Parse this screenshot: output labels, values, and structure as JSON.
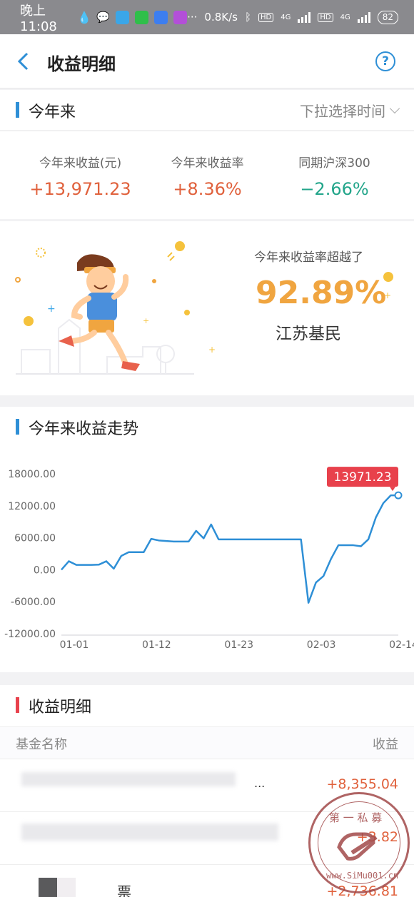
{
  "status_bar": {
    "time": "晚上11:08",
    "speed": "0.8K/s",
    "battery": "82",
    "hd1": "HD",
    "hd2": "HD",
    "net1": "4G",
    "net2": "4G",
    "dots": "···"
  },
  "header": {
    "title": "收益明细",
    "help": "?"
  },
  "period_section": {
    "title": "今年来",
    "selector": "下拉选择时间"
  },
  "stats": [
    {
      "label": "今年来收益(元)",
      "value": "+13,971.23",
      "color": "#e0613c"
    },
    {
      "label": "今年来收益率",
      "value": "+8.36%",
      "color": "#e0613c"
    },
    {
      "label": "同期沪深300",
      "value": "−2.66%",
      "color": "#22a58a"
    }
  ],
  "banner": {
    "label": "今年来收益率超越了",
    "value": "92.89%",
    "sub": "江苏基民"
  },
  "trend_section": {
    "title": "今年来收益走势"
  },
  "chart_data": {
    "type": "line",
    "x_ticks": [
      "01-01",
      "01-12",
      "01-23",
      "02-03",
      "02-14"
    ],
    "y_ticks": [
      "18000.00",
      "12000.00",
      "6000.00",
      "0.00",
      "-6000.00",
      "-12000.00"
    ],
    "ylim": [
      -12000,
      18000
    ],
    "x": [
      "01-01",
      "01-02",
      "01-03",
      "01-04",
      "01-05",
      "01-06",
      "01-07",
      "01-08",
      "01-09",
      "01-10",
      "01-11",
      "01-12",
      "01-13",
      "01-14",
      "01-15",
      "01-16",
      "01-17",
      "01-18",
      "01-19",
      "01-20",
      "01-21",
      "01-22",
      "01-23",
      "01-24",
      "01-25",
      "01-26",
      "01-27",
      "01-28",
      "01-29",
      "01-30",
      "01-31",
      "02-01",
      "02-02",
      "02-03",
      "02-04",
      "02-05",
      "02-06",
      "02-07",
      "02-08",
      "02-09",
      "02-10",
      "02-11",
      "02-12",
      "02-13",
      "02-14",
      "02-15"
    ],
    "series": [
      {
        "values": [
          0,
          1600,
          900,
          900,
          900,
          950,
          1600,
          200,
          2600,
          3300,
          3300,
          3300,
          5800,
          5500,
          5400,
          5300,
          5300,
          5300,
          7300,
          5900,
          8500,
          5700,
          5700,
          5700,
          5700,
          5700,
          5700,
          5700,
          5700,
          5700,
          5700,
          5700,
          5700,
          -6200,
          -2400,
          -1200,
          2000,
          4600,
          4600,
          4600,
          4400,
          5700,
          9800,
          12500,
          13971.23,
          13971.23
        ],
        "color": "#2e8fd6"
      }
    ],
    "tooltip": "13971.23",
    "tooltip_color": "#e8414c"
  },
  "detail_section": {
    "title": "收益明细",
    "col_name": "基金名称",
    "col_income": "收益",
    "rows": [
      {
        "name": "...",
        "value": "+8,355.04"
      },
      {
        "name": "",
        "value": "+3.82"
      },
      {
        "name": "票",
        "value": "+2,736.81"
      }
    ]
  },
  "colors": {
    "accent_blue": "#2e8fd6",
    "accent_red": "#e8414c",
    "gain": "#e0613c",
    "loss": "#22a58a",
    "highlight": "#f0a540"
  }
}
